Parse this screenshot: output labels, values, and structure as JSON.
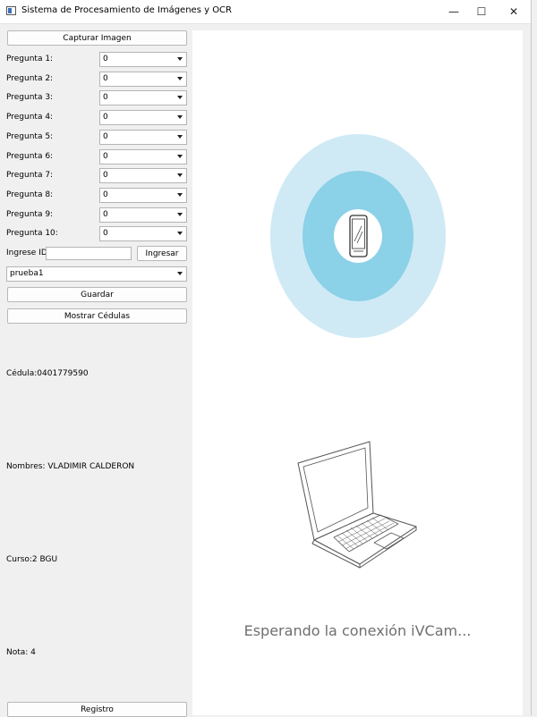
{
  "window": {
    "title": "Sistema de Procesamiento de Imágenes y OCR",
    "controls": {
      "minimize": "—",
      "maximize": "☐",
      "close": "✕"
    }
  },
  "left_panel": {
    "capture_button": "Capturar Imagen",
    "questions": [
      {
        "label": "Pregunta 1:",
        "value": "0"
      },
      {
        "label": "Pregunta 2:",
        "value": "0"
      },
      {
        "label": "Pregunta 3:",
        "value": "0"
      },
      {
        "label": "Pregunta 4:",
        "value": "0"
      },
      {
        "label": "Pregunta 5:",
        "value": "0"
      },
      {
        "label": "Pregunta 6:",
        "value": "0"
      },
      {
        "label": "Pregunta 7:",
        "value": "0"
      },
      {
        "label": "Pregunta 8:",
        "value": "0"
      },
      {
        "label": "Pregunta 9:",
        "value": "0"
      },
      {
        "label": "Pregunta 10:",
        "value": "0"
      }
    ],
    "id_label": "Ingrese ID",
    "id_value": "",
    "submit_button": "Ingresar",
    "record_select": "prueba1",
    "save_button": "Guardar",
    "show_button": "Mostrar Cédulas",
    "cedula": "Cédula:0401779590",
    "nombres": "Nombres: VLADIMIR CALDERON",
    "curso": "Curso:2 BGU",
    "nota": "Nota: 4",
    "registro_button": "Registro"
  },
  "camera_panel": {
    "status_text": "Esperando la conexión iVCam...",
    "colors": {
      "outer_ring": "#cfeaf5",
      "inner_ring": "#8bd1e7",
      "line": "#555555"
    },
    "icons": [
      "phone-icon",
      "laptop-icon"
    ]
  }
}
